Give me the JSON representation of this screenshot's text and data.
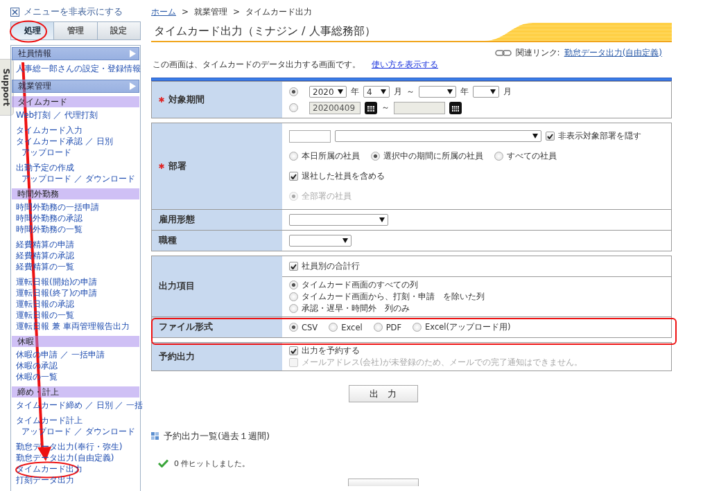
{
  "sidebar": {
    "toggle_label": "メニューを非表示にする",
    "tabs": [
      {
        "label": "処理",
        "selected": true
      },
      {
        "label": "管理",
        "selected": false
      },
      {
        "label": "設定",
        "selected": false
      }
    ],
    "blocks": [
      {
        "kind": "header",
        "label": "社員情報"
      },
      {
        "kind": "links",
        "lines": [
          {
            "text": "人事総一郎さんの設定・登録情報",
            "indent": false
          }
        ]
      },
      {
        "kind": "header",
        "label": "就業管理"
      },
      {
        "kind": "category",
        "label": "タイムカード"
      },
      {
        "kind": "links",
        "lines": [
          {
            "text": "Web打刻 ／ 代理打刻",
            "indent": false
          }
        ]
      },
      {
        "kind": "links",
        "lines": [
          {
            "text": "タイムカード入力",
            "indent": false
          },
          {
            "text": "タイムカード承認 ／ 日別",
            "indent": false
          },
          {
            "text": "アップロード",
            "indent": true
          }
        ]
      },
      {
        "kind": "links",
        "lines": [
          {
            "text": "出勤予定の作成",
            "indent": false
          },
          {
            "text": "アップロード ／ ダウンロード",
            "indent": true
          }
        ]
      },
      {
        "kind": "category",
        "label": "時間外勤務"
      },
      {
        "kind": "links",
        "lines": [
          {
            "text": "時間外勤務の一括申請",
            "indent": false
          },
          {
            "text": "時間外勤務の承認",
            "indent": false
          },
          {
            "text": "時間外勤務の一覧",
            "indent": false
          }
        ]
      },
      {
        "kind": "links",
        "lines": [
          {
            "text": "経費精算の申請",
            "indent": false
          },
          {
            "text": "経費精算の承認",
            "indent": false
          },
          {
            "text": "経費精算の一覧",
            "indent": false
          }
        ]
      },
      {
        "kind": "links",
        "lines": [
          {
            "text": "運転日報(開始)の申請",
            "indent": false
          },
          {
            "text": "運転日報(終了)の申請",
            "indent": false
          },
          {
            "text": "運転日報の承認",
            "indent": false
          },
          {
            "text": "運転日報の一覧",
            "indent": false
          },
          {
            "text": "運転日報 兼 車両管理報告出力",
            "indent": false
          }
        ]
      },
      {
        "kind": "category",
        "label": "休暇"
      },
      {
        "kind": "links",
        "lines": [
          {
            "text": "休暇の申請 ／ 一括申請",
            "indent": false
          },
          {
            "text": "休暇の承認",
            "indent": false
          },
          {
            "text": "休暇の一覧",
            "indent": false
          }
        ]
      },
      {
        "kind": "category",
        "label": "締め・計上"
      },
      {
        "kind": "links",
        "lines": [
          {
            "text": "タイムカード締め ／ 日別 ／ 一括",
            "indent": false
          }
        ]
      },
      {
        "kind": "links",
        "lines": [
          {
            "text": "タイムカード計上",
            "indent": false
          },
          {
            "text": "アップロード ／ ダウンロード",
            "indent": true
          }
        ]
      },
      {
        "kind": "links",
        "lines": [
          {
            "text": "勤怠データ出力(奉行・弥生)",
            "indent": false
          },
          {
            "text": "勤怠データ出力(自由定義)",
            "indent": false
          },
          {
            "text": "タイムカード出力",
            "indent": false
          },
          {
            "text": "打刻データ出力",
            "indent": false
          }
        ]
      }
    ]
  },
  "support_tab": "Support",
  "breadcrumb": [
    {
      "kind": "link",
      "text": "ホーム"
    },
    {
      "kind": "sep",
      "text": ">"
    },
    {
      "kind": "text",
      "text": "就業管理"
    },
    {
      "kind": "sep",
      "text": ">"
    },
    {
      "kind": "text",
      "text": "タイムカード出力"
    }
  ],
  "title": "タイムカード出力（ミナジン / 人事総務部）",
  "related": {
    "label": "関連リンク:",
    "link": "勤怠データ出力(自由定義)"
  },
  "description": {
    "text": "この画面は、タイムカードのデータ出力する画面です。",
    "link": "使い方を表示する"
  },
  "form": {
    "boxes": [
      {
        "sections": [
          {
            "label": "対象期間",
            "required": true,
            "cells": [
              {
                "kind": "normal",
                "lines": [
                  [
                    {
                      "kind": "radio",
                      "selected": true,
                      "disabled": false
                    },
                    {
                      "kind": "select",
                      "value": "2020"
                    },
                    {
                      "kind": "text",
                      "text": "年"
                    },
                    {
                      "kind": "select",
                      "value": "4"
                    },
                    {
                      "kind": "text",
                      "text": "月"
                    },
                    {
                      "kind": "text",
                      "text": "～"
                    },
                    {
                      "kind": "select"
                    },
                    {
                      "kind": "text",
                      "text": "年"
                    },
                    {
                      "kind": "select"
                    },
                    {
                      "kind": "text",
                      "text": "月"
                    }
                  ],
                  [
                    {
                      "kind": "radio",
                      "selected": false,
                      "disabled": false
                    },
                    {
                      "kind": "input",
                      "value": "20200409",
                      "disabled": true
                    },
                    {
                      "kind": "calendar"
                    },
                    {
                      "kind": "text",
                      "text": "～"
                    },
                    {
                      "kind": "input",
                      "disabled": true
                    },
                    {
                      "kind": "calendar"
                    }
                  ]
                ]
              }
            ]
          }
        ]
      },
      {
        "sections": [
          {
            "label": "部署",
            "required": true,
            "cells": [
              {
                "kind": "loose",
                "lines": [
                  [
                    {
                      "kind": "input",
                      "disabled": false
                    },
                    {
                      "kind": "select"
                    },
                    {
                      "kind": "checkbox",
                      "label": "非表示対象部署を隠す",
                      "checked": true,
                      "disabled": false
                    }
                  ],
                  [
                    {
                      "kind": "radio",
                      "label": "本日所属の社員",
                      "selected": false,
                      "disabled": false
                    },
                    {
                      "kind": "radio",
                      "label": "選択中の期間に所属の社員",
                      "selected": true,
                      "disabled": false
                    },
                    {
                      "kind": "radio",
                      "label": "すべての社員",
                      "selected": false,
                      "disabled": false
                    }
                  ],
                  [
                    {
                      "kind": "checkbox",
                      "label": "退社した社員を含める",
                      "checked": true,
                      "disabled": false
                    }
                  ],
                  [
                    {
                      "kind": "radio",
                      "label": "全部署の社員",
                      "selected": true,
                      "disabled": true
                    }
                  ]
                ]
              }
            ]
          },
          {
            "label": "雇用形態",
            "required": false,
            "cells": [
              {
                "kind": "normal",
                "lines": [
                  [
                    {
                      "kind": "select"
                    }
                  ]
                ]
              }
            ]
          },
          {
            "label": "職種",
            "required": false,
            "cells": [
              {
                "kind": "normal",
                "lines": [
                  [
                    {
                      "kind": "select"
                    }
                  ]
                ]
              }
            ]
          }
        ]
      },
      {
        "sections": [
          {
            "label": "出力項目",
            "required": false,
            "cells": [
              {
                "kind": "normal",
                "lines": [
                  [
                    {
                      "kind": "checkbox",
                      "label": "社員別の合計行",
                      "checked": true,
                      "disabled": false
                    }
                  ]
                ]
              },
              {
                "kind": "tight",
                "lines": [
                  [
                    {
                      "kind": "radio",
                      "label": "タイムカード画面のすべての列",
                      "selected": true,
                      "disabled": false
                    }
                  ],
                  [
                    {
                      "kind": "radio",
                      "label": "タイムカード画面から、打刻・申請　を除いた列",
                      "selected": false,
                      "disabled": false
                    }
                  ],
                  [
                    {
                      "kind": "radio",
                      "label": "承認・遅早・時間外　列のみ",
                      "selected": false,
                      "disabled": false
                    }
                  ]
                ]
              }
            ]
          },
          {
            "label": "ファイル形式",
            "required": false,
            "cells": [
              {
                "kind": "normal",
                "lines": [
                  [
                    {
                      "kind": "radio",
                      "label": "CSV",
                      "selected": true,
                      "disabled": false
                    },
                    {
                      "kind": "radio",
                      "label": "Excel",
                      "selected": false,
                      "disabled": false
                    },
                    {
                      "kind": "radio",
                      "label": "PDF",
                      "selected": false,
                      "disabled": false
                    },
                    {
                      "kind": "radio",
                      "label": "Excel(アップロード用)",
                      "selected": false,
                      "disabled": false
                    }
                  ]
                ]
              }
            ]
          }
        ]
      },
      {
        "sections": [
          {
            "label": "予約出力",
            "required": false,
            "cells": [
              {
                "kind": "tight",
                "lines": [
                  [
                    {
                      "kind": "checkbox",
                      "label": "出力を予約する",
                      "checked": true,
                      "disabled": false
                    }
                  ],
                  [
                    {
                      "kind": "checkbox",
                      "label": "メールアドレス(会社)が未登録のため、メールでの完了通知はできません。",
                      "checked": false,
                      "disabled": true
                    }
                  ]
                ]
              }
            ]
          }
        ]
      }
    ]
  },
  "submit_button": "出　力",
  "history": {
    "heading": "予約出力一覧(過去１週間)",
    "result": "0 件ヒットしました。"
  }
}
